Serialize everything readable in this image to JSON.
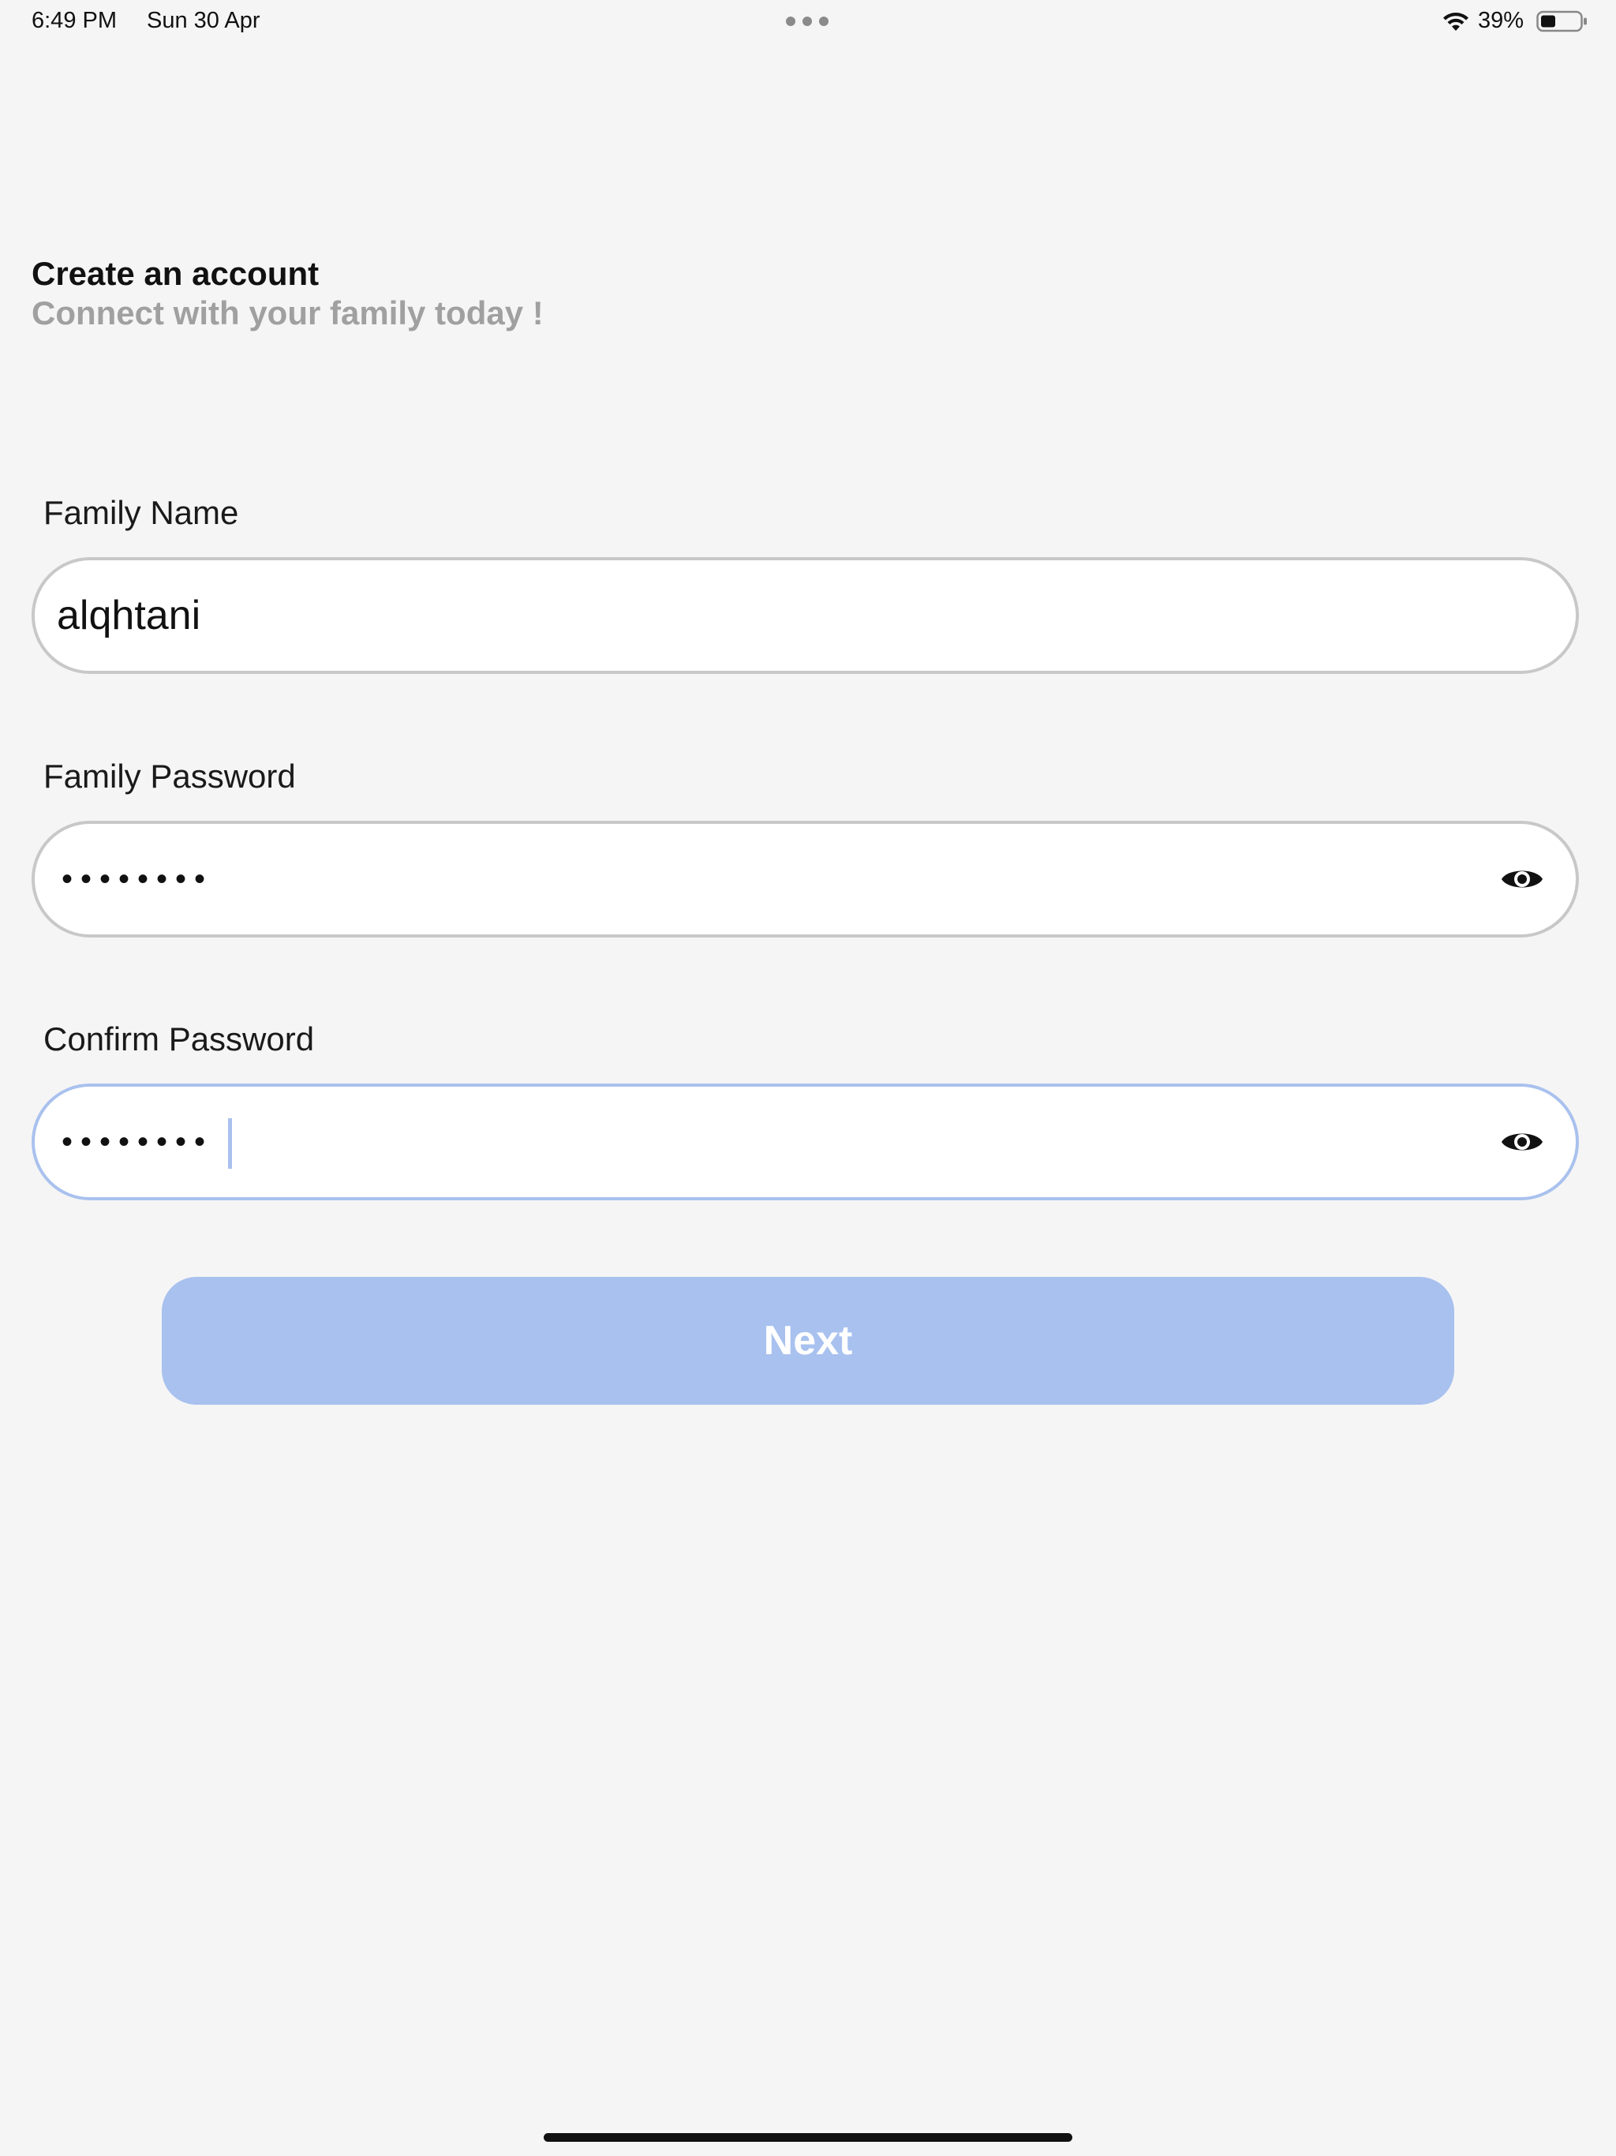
{
  "status_bar": {
    "time": "6:49 PM",
    "date": "Sun 30 Apr",
    "battery_percent": "39%",
    "battery_level": 0.39,
    "icons": [
      "multitask-dots-icon",
      "wifi-icon",
      "battery-icon"
    ]
  },
  "header": {
    "title": "Create an account",
    "subtitle": "Connect with your family today !"
  },
  "form": {
    "family_name": {
      "label": "Family Name",
      "value": "alqhtani"
    },
    "family_password": {
      "label": "Family Password",
      "masked_value": "••••••••",
      "toggle_icon": "eye-icon"
    },
    "confirm_password": {
      "label": "Confirm Password",
      "masked_value": "••••••••",
      "toggle_icon": "eye-icon",
      "focused": true
    }
  },
  "actions": {
    "next_label": "Next"
  },
  "colors": {
    "background": "#f5f5f5",
    "accent": "#a8c1ef",
    "field_border": "#c8c8c8",
    "subtitle": "#a0a0a0"
  }
}
